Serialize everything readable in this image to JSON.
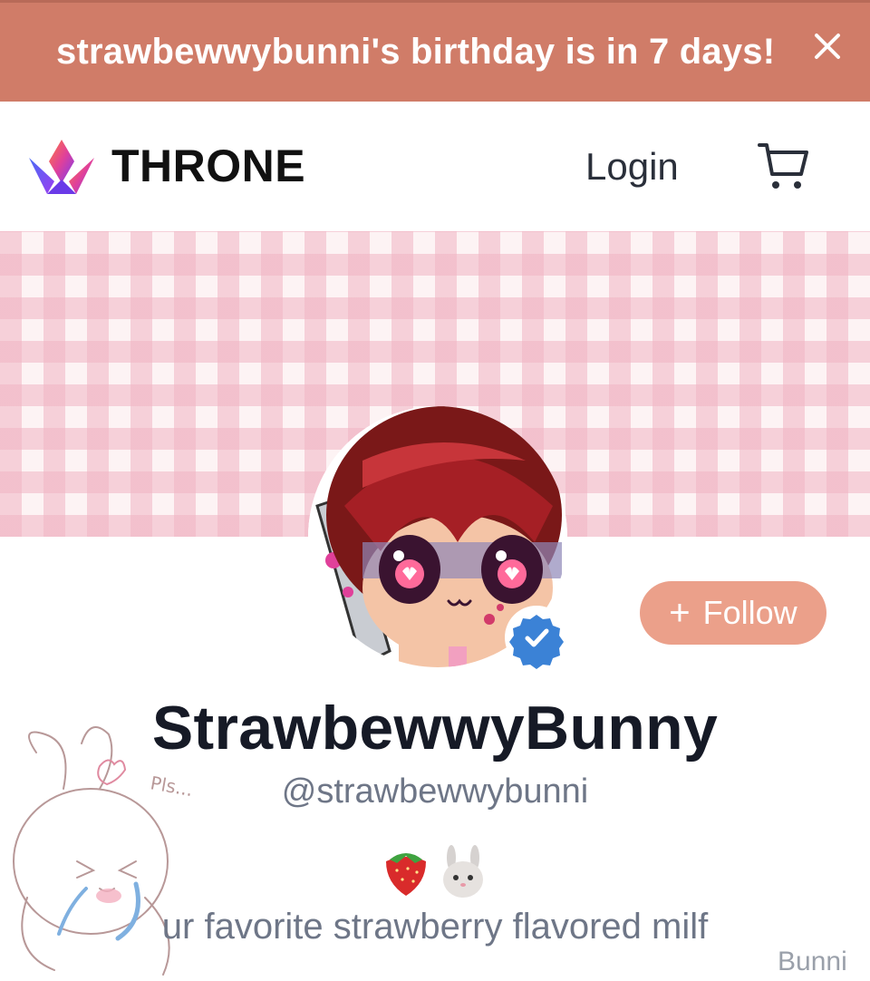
{
  "banner": {
    "text": "strawbewwybunni's birthday is in 7 days!",
    "close_icon": "close-icon",
    "color": "#d07c68"
  },
  "nav": {
    "logo_text": "THRONE",
    "logo_icon": "crown-logo-icon",
    "login_label": "Login",
    "cart_icon": "cart-icon"
  },
  "profile": {
    "display_name": "StrawbewwyBunny",
    "handle": "@strawbewwybunni",
    "emojis": "🍓 🐰",
    "bio": "ur favorite strawberry flavored milf",
    "verified_icon": "verified-badge-icon",
    "follow_label": "Follow",
    "follow_color": "#eba08a"
  },
  "sketch": {
    "caption": "Pls..."
  },
  "watermark": {
    "text": "Bunni"
  }
}
